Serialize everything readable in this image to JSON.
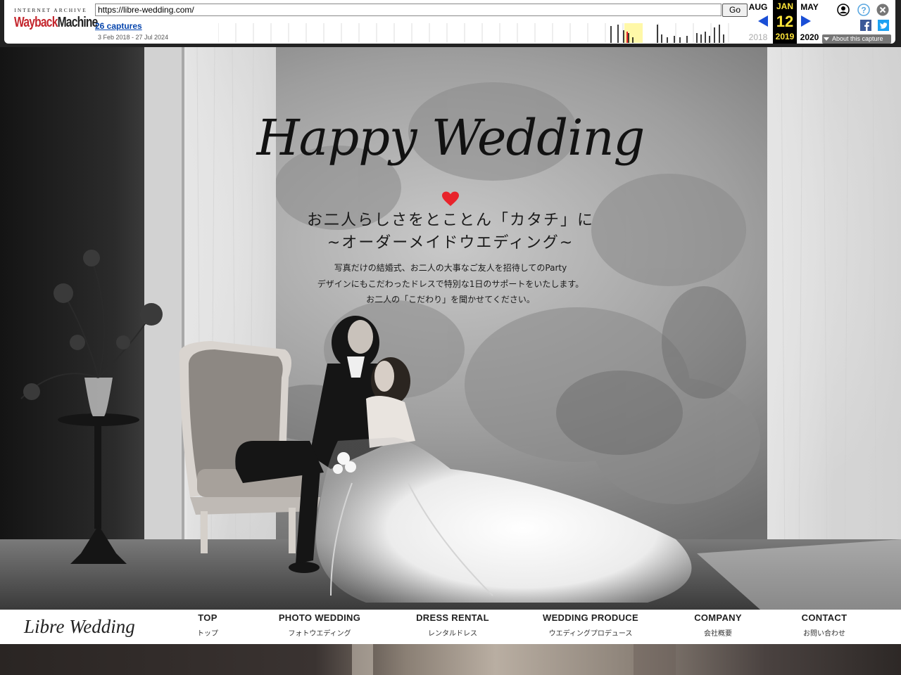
{
  "wayback": {
    "logo_top": "INTERNET ARCHIVE",
    "logo_wayback": "Wayback",
    "logo_machine": "Machine",
    "url": "https://libre-wedding.com/",
    "go_label": "Go",
    "captures_label": "26 captures",
    "date_range": "3 Feb 2018 - 27 Jul 2024",
    "prev_month": "AUG",
    "prev_year": "2018",
    "cur_month": "JAN",
    "cur_day": "12",
    "cur_year": "2019",
    "next_month": "MAY",
    "next_year": "2020",
    "about_label": "About this capture"
  },
  "hero": {
    "script_title": "Happy Wedding",
    "tagline_1": "お二人らしさをとことん「カタチ」に",
    "tagline_2": "~オーダーメイドウエディング~",
    "desc_1": "写真だけの結婚式、お二人の大事なご友人を招待してのParty",
    "desc_2": "デザインにもこだわったドレスで特別な1日のサポートをいたします。",
    "desc_3": "お二人の「こだわり」を聞かせてください。"
  },
  "nav": {
    "logo": "Libre Wedding",
    "items": [
      {
        "en": "TOP",
        "jp": "トップ"
      },
      {
        "en": "PHOTO WEDDING",
        "jp": "フォトウエディング"
      },
      {
        "en": "DRESS RENTAL",
        "jp": "レンタルドレス"
      },
      {
        "en": "WEDDING PRODUCE",
        "jp": "ウエディングプロデュース"
      },
      {
        "en": "COMPANY",
        "jp": "会社概要"
      },
      {
        "en": "CONTACT",
        "jp": "お問い合わせ"
      }
    ]
  },
  "colors": {
    "heart": "#e8232b",
    "wayback_blue": "#1a4fd6",
    "highlight_yellow": "#ffe63a"
  }
}
